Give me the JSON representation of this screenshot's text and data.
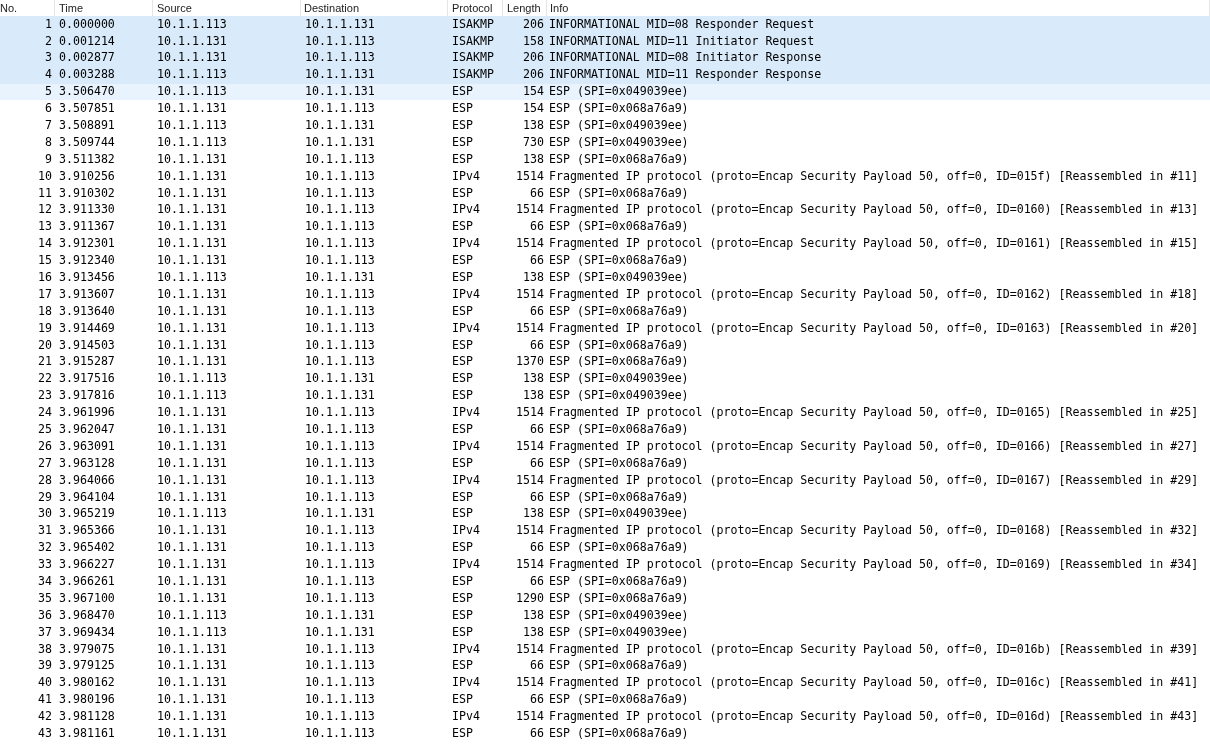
{
  "table": {
    "columns": [
      "No.",
      "Time",
      "Source",
      "Destination",
      "Protocol",
      "Length",
      "Info"
    ],
    "rows": [
      {
        "cells": [
          "1",
          "0.000000",
          "10.1.1.113",
          "10.1.1.131",
          "ISAKMP",
          "206",
          "INFORMATIONAL MID=08 Responder Request"
        ],
        "selected": true,
        "hovered": false
      },
      {
        "cells": [
          "2",
          "0.001214",
          "10.1.1.131",
          "10.1.1.113",
          "ISAKMP",
          "158",
          "INFORMATIONAL MID=11 Initiator Request"
        ],
        "selected": true,
        "hovered": false
      },
      {
        "cells": [
          "3",
          "0.002877",
          "10.1.1.131",
          "10.1.1.113",
          "ISAKMP",
          "206",
          "INFORMATIONAL MID=08 Initiator Response"
        ],
        "selected": true,
        "hovered": false
      },
      {
        "cells": [
          "4",
          "0.003288",
          "10.1.1.113",
          "10.1.1.131",
          "ISAKMP",
          "206",
          "INFORMATIONAL MID=11 Responder Response"
        ],
        "selected": true,
        "hovered": false
      },
      {
        "cells": [
          "5",
          "3.506470",
          "10.1.1.113",
          "10.1.1.131",
          "ESP",
          "154",
          "ESP (SPI=0x049039ee)"
        ],
        "selected": false,
        "hovered": true
      },
      {
        "cells": [
          "6",
          "3.507851",
          "10.1.1.131",
          "10.1.1.113",
          "ESP",
          "154",
          "ESP (SPI=0x068a76a9)"
        ],
        "selected": false,
        "hovered": false
      },
      {
        "cells": [
          "7",
          "3.508891",
          "10.1.1.113",
          "10.1.1.131",
          "ESP",
          "138",
          "ESP (SPI=0x049039ee)"
        ],
        "selected": false,
        "hovered": false
      },
      {
        "cells": [
          "8",
          "3.509744",
          "10.1.1.113",
          "10.1.1.131",
          "ESP",
          "730",
          "ESP (SPI=0x049039ee)"
        ],
        "selected": false,
        "hovered": false
      },
      {
        "cells": [
          "9",
          "3.511382",
          "10.1.1.131",
          "10.1.1.113",
          "ESP",
          "138",
          "ESP (SPI=0x068a76a9)"
        ],
        "selected": false,
        "hovered": false
      },
      {
        "cells": [
          "10",
          "3.910256",
          "10.1.1.131",
          "10.1.1.113",
          "IPv4",
          "1514",
          "Fragmented IP protocol (proto=Encap Security Payload 50, off=0, ID=015f) [Reassembled in #11]"
        ],
        "selected": false,
        "hovered": false
      },
      {
        "cells": [
          "11",
          "3.910302",
          "10.1.1.131",
          "10.1.1.113",
          "ESP",
          "66",
          "ESP (SPI=0x068a76a9)"
        ],
        "selected": false,
        "hovered": false
      },
      {
        "cells": [
          "12",
          "3.911330",
          "10.1.1.131",
          "10.1.1.113",
          "IPv4",
          "1514",
          "Fragmented IP protocol (proto=Encap Security Payload 50, off=0, ID=0160) [Reassembled in #13]"
        ],
        "selected": false,
        "hovered": false
      },
      {
        "cells": [
          "13",
          "3.911367",
          "10.1.1.131",
          "10.1.1.113",
          "ESP",
          "66",
          "ESP (SPI=0x068a76a9)"
        ],
        "selected": false,
        "hovered": false
      },
      {
        "cells": [
          "14",
          "3.912301",
          "10.1.1.131",
          "10.1.1.113",
          "IPv4",
          "1514",
          "Fragmented IP protocol (proto=Encap Security Payload 50, off=0, ID=0161) [Reassembled in #15]"
        ],
        "selected": false,
        "hovered": false
      },
      {
        "cells": [
          "15",
          "3.912340",
          "10.1.1.131",
          "10.1.1.113",
          "ESP",
          "66",
          "ESP (SPI=0x068a76a9)"
        ],
        "selected": false,
        "hovered": false
      },
      {
        "cells": [
          "16",
          "3.913456",
          "10.1.1.113",
          "10.1.1.131",
          "ESP",
          "138",
          "ESP (SPI=0x049039ee)"
        ],
        "selected": false,
        "hovered": false
      },
      {
        "cells": [
          "17",
          "3.913607",
          "10.1.1.131",
          "10.1.1.113",
          "IPv4",
          "1514",
          "Fragmented IP protocol (proto=Encap Security Payload 50, off=0, ID=0162) [Reassembled in #18]"
        ],
        "selected": false,
        "hovered": false
      },
      {
        "cells": [
          "18",
          "3.913640",
          "10.1.1.131",
          "10.1.1.113",
          "ESP",
          "66",
          "ESP (SPI=0x068a76a9)"
        ],
        "selected": false,
        "hovered": false
      },
      {
        "cells": [
          "19",
          "3.914469",
          "10.1.1.131",
          "10.1.1.113",
          "IPv4",
          "1514",
          "Fragmented IP protocol (proto=Encap Security Payload 50, off=0, ID=0163) [Reassembled in #20]"
        ],
        "selected": false,
        "hovered": false
      },
      {
        "cells": [
          "20",
          "3.914503",
          "10.1.1.131",
          "10.1.1.113",
          "ESP",
          "66",
          "ESP (SPI=0x068a76a9)"
        ],
        "selected": false,
        "hovered": false
      },
      {
        "cells": [
          "21",
          "3.915287",
          "10.1.1.131",
          "10.1.1.113",
          "ESP",
          "1370",
          "ESP (SPI=0x068a76a9)"
        ],
        "selected": false,
        "hovered": false
      },
      {
        "cells": [
          "22",
          "3.917516",
          "10.1.1.113",
          "10.1.1.131",
          "ESP",
          "138",
          "ESP (SPI=0x049039ee)"
        ],
        "selected": false,
        "hovered": false
      },
      {
        "cells": [
          "23",
          "3.917816",
          "10.1.1.113",
          "10.1.1.131",
          "ESP",
          "138",
          "ESP (SPI=0x049039ee)"
        ],
        "selected": false,
        "hovered": false
      },
      {
        "cells": [
          "24",
          "3.961996",
          "10.1.1.131",
          "10.1.1.113",
          "IPv4",
          "1514",
          "Fragmented IP protocol (proto=Encap Security Payload 50, off=0, ID=0165) [Reassembled in #25]"
        ],
        "selected": false,
        "hovered": false
      },
      {
        "cells": [
          "25",
          "3.962047",
          "10.1.1.131",
          "10.1.1.113",
          "ESP",
          "66",
          "ESP (SPI=0x068a76a9)"
        ],
        "selected": false,
        "hovered": false
      },
      {
        "cells": [
          "26",
          "3.963091",
          "10.1.1.131",
          "10.1.1.113",
          "IPv4",
          "1514",
          "Fragmented IP protocol (proto=Encap Security Payload 50, off=0, ID=0166) [Reassembled in #27]"
        ],
        "selected": false,
        "hovered": false
      },
      {
        "cells": [
          "27",
          "3.963128",
          "10.1.1.131",
          "10.1.1.113",
          "ESP",
          "66",
          "ESP (SPI=0x068a76a9)"
        ],
        "selected": false,
        "hovered": false
      },
      {
        "cells": [
          "28",
          "3.964066",
          "10.1.1.131",
          "10.1.1.113",
          "IPv4",
          "1514",
          "Fragmented IP protocol (proto=Encap Security Payload 50, off=0, ID=0167) [Reassembled in #29]"
        ],
        "selected": false,
        "hovered": false
      },
      {
        "cells": [
          "29",
          "3.964104",
          "10.1.1.131",
          "10.1.1.113",
          "ESP",
          "66",
          "ESP (SPI=0x068a76a9)"
        ],
        "selected": false,
        "hovered": false
      },
      {
        "cells": [
          "30",
          "3.965219",
          "10.1.1.113",
          "10.1.1.131",
          "ESP",
          "138",
          "ESP (SPI=0x049039ee)"
        ],
        "selected": false,
        "hovered": false
      },
      {
        "cells": [
          "31",
          "3.965366",
          "10.1.1.131",
          "10.1.1.113",
          "IPv4",
          "1514",
          "Fragmented IP protocol (proto=Encap Security Payload 50, off=0, ID=0168) [Reassembled in #32]"
        ],
        "selected": false,
        "hovered": false
      },
      {
        "cells": [
          "32",
          "3.965402",
          "10.1.1.131",
          "10.1.1.113",
          "ESP",
          "66",
          "ESP (SPI=0x068a76a9)"
        ],
        "selected": false,
        "hovered": false
      },
      {
        "cells": [
          "33",
          "3.966227",
          "10.1.1.131",
          "10.1.1.113",
          "IPv4",
          "1514",
          "Fragmented IP protocol (proto=Encap Security Payload 50, off=0, ID=0169) [Reassembled in #34]"
        ],
        "selected": false,
        "hovered": false
      },
      {
        "cells": [
          "34",
          "3.966261",
          "10.1.1.131",
          "10.1.1.113",
          "ESP",
          "66",
          "ESP (SPI=0x068a76a9)"
        ],
        "selected": false,
        "hovered": false
      },
      {
        "cells": [
          "35",
          "3.967100",
          "10.1.1.131",
          "10.1.1.113",
          "ESP",
          "1290",
          "ESP (SPI=0x068a76a9)"
        ],
        "selected": false,
        "hovered": false
      },
      {
        "cells": [
          "36",
          "3.968470",
          "10.1.1.113",
          "10.1.1.131",
          "ESP",
          "138",
          "ESP (SPI=0x049039ee)"
        ],
        "selected": false,
        "hovered": false
      },
      {
        "cells": [
          "37",
          "3.969434",
          "10.1.1.113",
          "10.1.1.131",
          "ESP",
          "138",
          "ESP (SPI=0x049039ee)"
        ],
        "selected": false,
        "hovered": false
      },
      {
        "cells": [
          "38",
          "3.979075",
          "10.1.1.131",
          "10.1.1.113",
          "IPv4",
          "1514",
          "Fragmented IP protocol (proto=Encap Security Payload 50, off=0, ID=016b) [Reassembled in #39]"
        ],
        "selected": false,
        "hovered": false
      },
      {
        "cells": [
          "39",
          "3.979125",
          "10.1.1.131",
          "10.1.1.113",
          "ESP",
          "66",
          "ESP (SPI=0x068a76a9)"
        ],
        "selected": false,
        "hovered": false
      },
      {
        "cells": [
          "40",
          "3.980162",
          "10.1.1.131",
          "10.1.1.113",
          "IPv4",
          "1514",
          "Fragmented IP protocol (proto=Encap Security Payload 50, off=0, ID=016c) [Reassembled in #41]"
        ],
        "selected": false,
        "hovered": false
      },
      {
        "cells": [
          "41",
          "3.980196",
          "10.1.1.131",
          "10.1.1.113",
          "ESP",
          "66",
          "ESP (SPI=0x068a76a9)"
        ],
        "selected": false,
        "hovered": false
      },
      {
        "cells": [
          "42",
          "3.981128",
          "10.1.1.131",
          "10.1.1.113",
          "IPv4",
          "1514",
          "Fragmented IP protocol (proto=Encap Security Payload 50, off=0, ID=016d) [Reassembled in #43]"
        ],
        "selected": false,
        "hovered": false
      },
      {
        "cells": [
          "43",
          "3.981161",
          "10.1.1.131",
          "10.1.1.113",
          "ESP",
          "66",
          "ESP (SPI=0x068a76a9)"
        ],
        "selected": false,
        "hovered": false
      }
    ]
  }
}
